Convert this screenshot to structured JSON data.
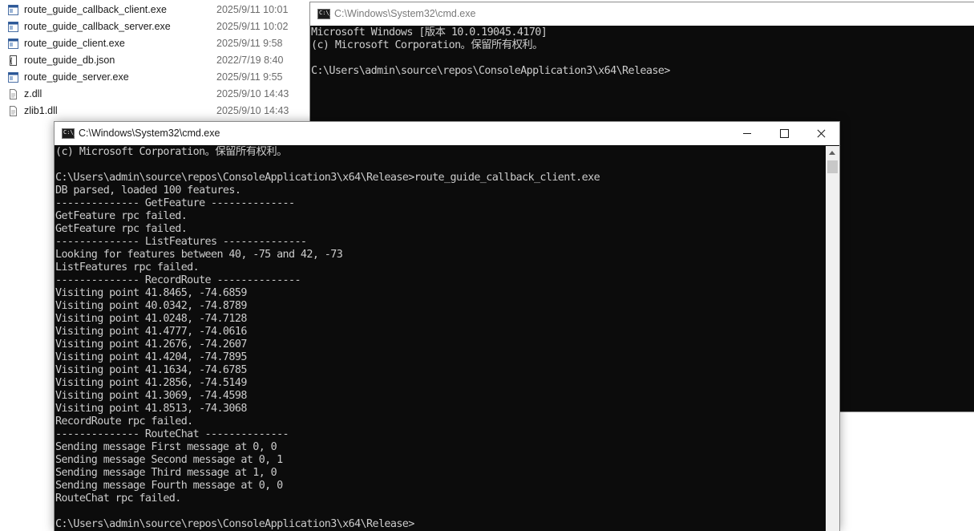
{
  "explorer": {
    "files": [
      {
        "name": "route_guide_callback_client.exe",
        "modified": "2025/9/11 10:01",
        "icon": "exe-file-icon"
      },
      {
        "name": "route_guide_callback_server.exe",
        "modified": "2025/9/11 10:02",
        "icon": "exe-file-icon"
      },
      {
        "name": "route_guide_client.exe",
        "modified": "2025/9/11 9:58",
        "icon": "exe-file-icon"
      },
      {
        "name": "route_guide_db.json",
        "modified": "2022/7/19 8:40",
        "icon": "json-file-icon"
      },
      {
        "name": "route_guide_server.exe",
        "modified": "2025/9/11 9:55",
        "icon": "exe-file-icon"
      },
      {
        "name": "z.dll",
        "modified": "2025/9/10 14:43",
        "icon": "dll-file-icon"
      },
      {
        "name": "zlib1.dll",
        "modified": "2025/9/10 14:43",
        "icon": "dll-file-icon"
      }
    ]
  },
  "back_window": {
    "title": "C:\\Windows\\System32\\cmd.exe",
    "lines": [
      "Microsoft Windows [版本 10.0.19045.4170]",
      "(c) Microsoft Corporation。保留所有权利。",
      "",
      "C:\\Users\\admin\\source\\repos\\ConsoleApplication3\\x64\\Release>"
    ]
  },
  "front_window": {
    "title": "C:\\Windows\\System32\\cmd.exe",
    "lines": [
      "(c) Microsoft Corporation。保留所有权利。",
      "",
      "C:\\Users\\admin\\source\\repos\\ConsoleApplication3\\x64\\Release>route_guide_callback_client.exe",
      "DB parsed, loaded 100 features.",
      "-------------- GetFeature --------------",
      "GetFeature rpc failed.",
      "GetFeature rpc failed.",
      "-------------- ListFeatures --------------",
      "Looking for features between 40, -75 and 42, -73",
      "ListFeatures rpc failed.",
      "-------------- RecordRoute --------------",
      "Visiting point 41.8465, -74.6859",
      "Visiting point 40.0342, -74.8789",
      "Visiting point 41.0248, -74.7128",
      "Visiting point 41.4777, -74.0616",
      "Visiting point 41.2676, -74.2607",
      "Visiting point 41.4204, -74.7895",
      "Visiting point 41.1634, -74.6785",
      "Visiting point 41.2856, -74.5149",
      "Visiting point 41.3069, -74.4598",
      "Visiting point 41.8513, -74.3068",
      "RecordRoute rpc failed.",
      "-------------- RouteChat --------------",
      "Sending message First message at 0, 0",
      "Sending message Second message at 0, 1",
      "Sending message Third message at 1, 0",
      "Sending message Fourth message at 0, 0",
      "RouteChat rpc failed.",
      "",
      "C:\\Users\\admin\\source\\repos\\ConsoleApplication3\\x64\\Release>"
    ]
  },
  "colors": {
    "console_bg": "#0c0c0c",
    "console_text": "#cccccc",
    "titlebar_bg": "#ffffff"
  }
}
